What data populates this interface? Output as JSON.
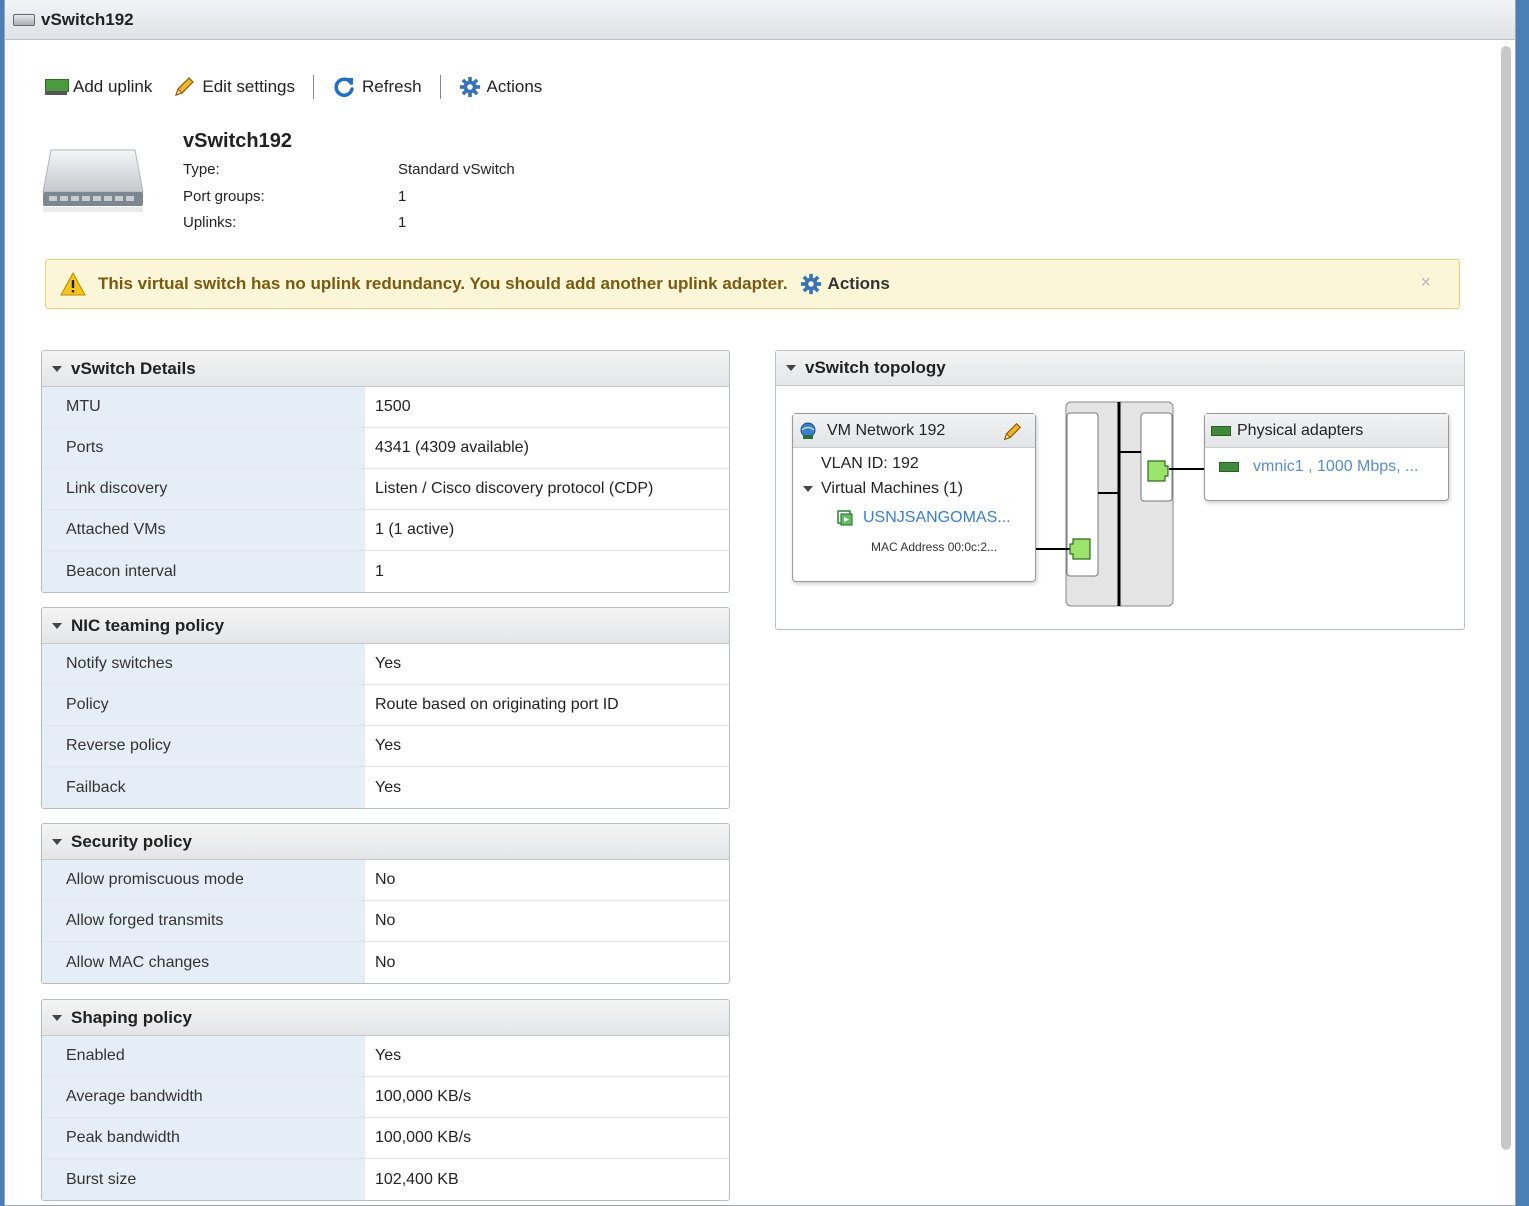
{
  "window": {
    "title": "vSwitch192"
  },
  "toolbar": {
    "add_uplink": "Add uplink",
    "edit_settings": "Edit settings",
    "refresh": "Refresh",
    "actions": "Actions"
  },
  "summary": {
    "name": "vSwitch192",
    "rows": [
      {
        "label": "Type:",
        "value": "Standard vSwitch"
      },
      {
        "label": "Port groups:",
        "value": "1"
      },
      {
        "label": "Uplinks:",
        "value": "1"
      }
    ]
  },
  "alert": {
    "message": "This virtual switch has no uplink redundancy. You should add another uplink adapter.",
    "actions": "Actions",
    "close": "×"
  },
  "details": {
    "title": "vSwitch Details",
    "rows": [
      {
        "label": "MTU",
        "value": "1500"
      },
      {
        "label": "Ports",
        "value": "4341 (4309 available)"
      },
      {
        "label": "Link discovery",
        "value": "Listen / Cisco discovery protocol (CDP)"
      },
      {
        "label": "Attached VMs",
        "value": "1 (1 active)"
      },
      {
        "label": "Beacon interval",
        "value": "1"
      }
    ]
  },
  "nic_teaming": {
    "title": "NIC teaming policy",
    "rows": [
      {
        "label": "Notify switches",
        "value": "Yes"
      },
      {
        "label": "Policy",
        "value": "Route based on originating port ID"
      },
      {
        "label": "Reverse policy",
        "value": "Yes"
      },
      {
        "label": "Failback",
        "value": "Yes"
      }
    ]
  },
  "security": {
    "title": "Security policy",
    "rows": [
      {
        "label": "Allow promiscuous mode",
        "value": "No"
      },
      {
        "label": "Allow forged transmits",
        "value": "No"
      },
      {
        "label": "Allow MAC changes",
        "value": "No"
      }
    ]
  },
  "shaping": {
    "title": "Shaping policy",
    "rows": [
      {
        "label": "Enabled",
        "value": "Yes"
      },
      {
        "label": "Average bandwidth",
        "value": "100,000 KB/s"
      },
      {
        "label": "Peak bandwidth",
        "value": "100,000 KB/s"
      },
      {
        "label": "Burst size",
        "value": "102,400 KB"
      }
    ]
  },
  "topology": {
    "title": "vSwitch topology",
    "port_group": {
      "name": "VM Network 192",
      "vlan": "VLAN ID: 192",
      "vms_label": "Virtual Machines (1)",
      "vm_name": "USNJSANGOMAS...",
      "mac": "MAC Address 00:0c:2..."
    },
    "physical": {
      "title": "Physical adapters",
      "adapter": "vmnic1 , 1000 Mbps, ..."
    }
  },
  "colors": {
    "accent_link": "#3a7fc8",
    "alert_bg": "#fbf6d8",
    "key_cell_bg": "#e5eef6",
    "port_green": "#9be36a"
  }
}
